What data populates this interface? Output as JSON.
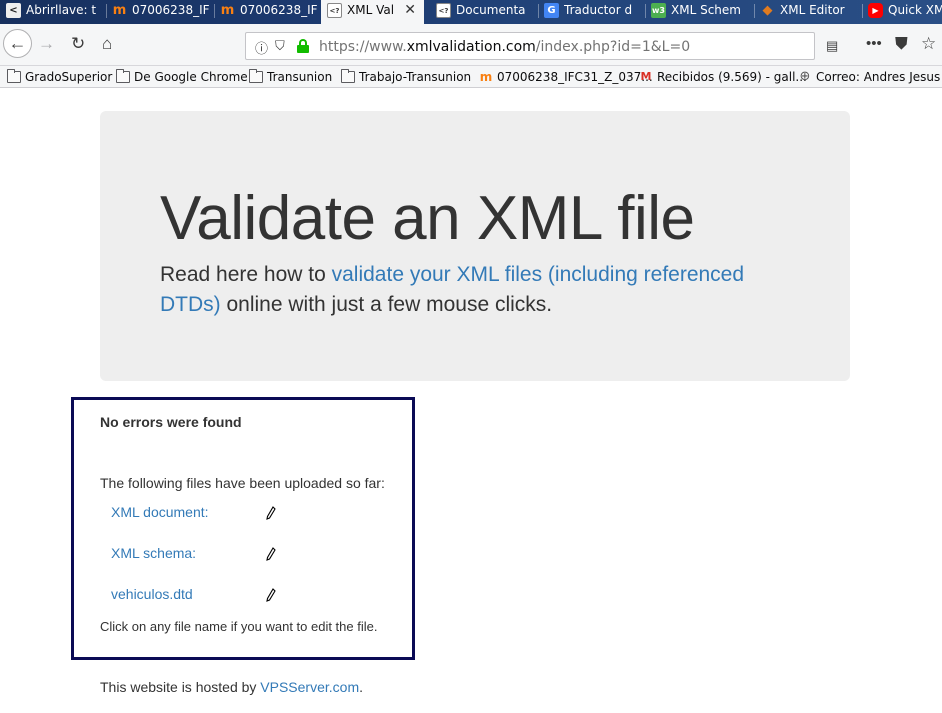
{
  "browser": {
    "tabs": [
      {
        "label": "Abrirllave: t",
        "favicon": "abrirllave-icon",
        "fav_text": "<",
        "fav_color": "#444444",
        "active": false
      },
      {
        "label": "07006238_IF",
        "favicon": "moodle-icon",
        "fav_text": "m",
        "fav_color": "#f98012",
        "active": false
      },
      {
        "label": "07006238_IF",
        "favicon": "moodle-icon",
        "fav_text": "m",
        "fav_color": "#f98012",
        "active": false
      },
      {
        "label": "XML Val",
        "favicon": "xml-page-icon",
        "fav_text": "<?",
        "fav_color": "#555555",
        "active": true
      },
      {
        "label": "Documenta",
        "favicon": "xml-page-icon",
        "fav_text": "<?",
        "fav_color": "#555555",
        "active": false
      },
      {
        "label": "Traductor d",
        "favicon": "google-translate-icon",
        "fav_text": "G",
        "fav_color": "#4285f4",
        "active": false
      },
      {
        "label": "XML Schem",
        "favicon": "w3schools-icon",
        "fav_text": "w3",
        "fav_color": "#4caf50",
        "active": false
      },
      {
        "label": "XML Editor",
        "favicon": "xml-editor-icon",
        "fav_text": "◆",
        "fav_color": "#e07b1f",
        "active": false
      },
      {
        "label": "Quick XM",
        "favicon": "youtube-icon",
        "fav_text": "▶",
        "fav_color": "#ff0000",
        "active": false
      }
    ],
    "url_prefix": "https://www.",
    "url_host": "xmlvalidation.com",
    "url_path": "/index.php?id=1&L=0",
    "bookmarks": [
      {
        "label": "GradoSuperior",
        "icon": "folder-icon"
      },
      {
        "label": "De Google Chrome",
        "icon": "folder-icon"
      },
      {
        "label": "Transunion",
        "icon": "folder-icon"
      },
      {
        "label": "Trabajo-Transunion",
        "icon": "folder-icon"
      },
      {
        "label": "07006238_IFC31_Z_037...",
        "icon": "moodle-icon"
      },
      {
        "label": "Recibidos (9.569) - gall...",
        "icon": "gmail-icon"
      },
      {
        "label": "Correo: Andres Jesus ...",
        "icon": "globe-icon"
      }
    ]
  },
  "page": {
    "heading": "Validate an XML file",
    "lead_before": "Read here how to ",
    "lead_link": "validate your XML files (including referenced DTDs)",
    "lead_after": " online with just a few mouse clicks.",
    "result_title": "No errors were found",
    "uploaded_intro": "The following files have been uploaded so far:",
    "files": [
      {
        "name": "XML document:"
      },
      {
        "name": "XML schema:"
      },
      {
        "name": "vehiculos.dtd"
      }
    ],
    "edit_hint": "Click on any file name if you want to edit the file.",
    "footer_before": "This website is hosted by ",
    "footer_link": "VPSServer.com",
    "footer_after": "."
  },
  "colors": {
    "link": "#337ab7",
    "jumbotron_bg": "#eeeeee",
    "result_border": "#0a0a55",
    "lock_green": "#12bc00"
  }
}
